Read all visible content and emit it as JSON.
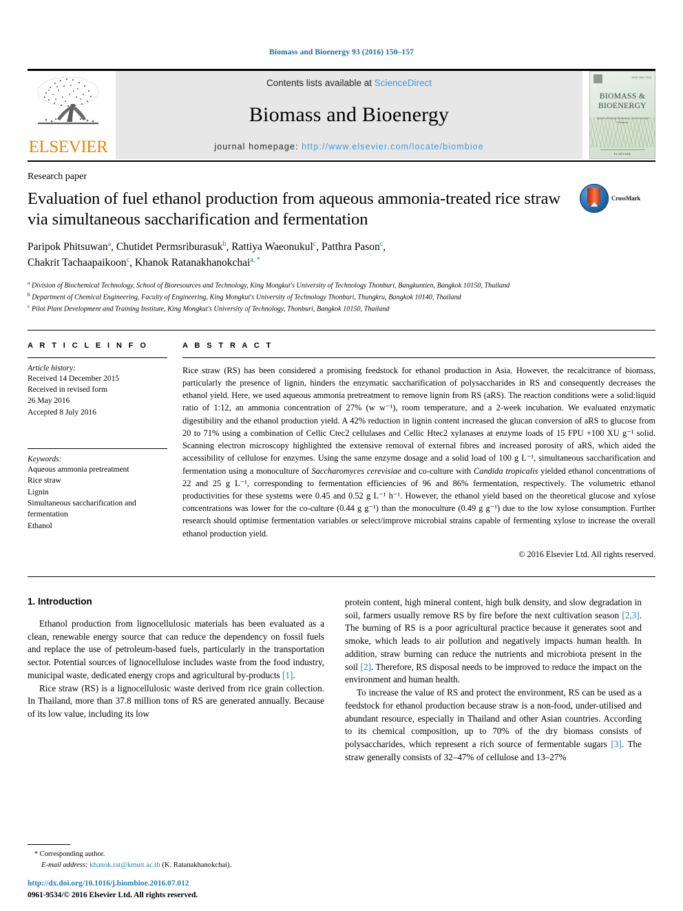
{
  "running_head": "Biomass and Bioenergy 93 (2016) 150–157",
  "masthead": {
    "contents_prefix": "Contents lists available at ",
    "sciencedirect": "ScienceDirect",
    "journal_title": "Biomass and Bioenergy",
    "homepage_prefix": "journal homepage: ",
    "homepage_url": "http://www.elsevier.com/locate/biombioe",
    "publisher_name": "ELSEVIER",
    "cover": {
      "title": "BIOMASS & BIOENERGY",
      "issn_line": "ISSN 0961-9534",
      "subtitle": "Aimed at Biomass Production, Conversion and Utilisation",
      "footer": "ELSEVIER"
    },
    "link_color": "#3b9ad9",
    "panel_color": "#e7e7e7",
    "elsevier_orange": "#f08100"
  },
  "article": {
    "type": "Research paper",
    "title": "Evaluation of fuel ethanol production from aqueous ammonia-treated rice straw via simultaneous saccharification and fermentation",
    "crossmark_label": "CrossMark",
    "authors": [
      {
        "name": "Paripok Phitsuwan",
        "marks": "a",
        "sep": ", "
      },
      {
        "name": "Chutidet Permsriburasuk",
        "marks": "b",
        "sep": ", "
      },
      {
        "name": "Rattiya Waeonukul",
        "marks": "c",
        "sep": ", "
      },
      {
        "name": "Patthra Pason",
        "marks": "c",
        "sep": ", "
      },
      {
        "name": "Chakrit Tachaapaikoon",
        "marks": "c",
        "sep": ", "
      },
      {
        "name": "Khanok Ratanakhanokchai",
        "marks": "a, *",
        "sep": ""
      }
    ],
    "affiliations": [
      {
        "mark": "a",
        "text": "Division of Biochemical Technology, School of Bioresources and Technology, King Mongkut's University of Technology Thonburi, Bangkuntien, Bangkok 10150, Thailand"
      },
      {
        "mark": "b",
        "text": "Department of Chemical Engineering, Faculty of Engineering, King Mongkut's University of Technology Thonburi, Thungkru, Bangkok 10140, Thailand"
      },
      {
        "mark": "c",
        "text": "Pilot Plant Development and Training Institute, King Mongkut's University of Technology, Thonburi, Bangkok 10150, Thailand"
      }
    ]
  },
  "article_info": {
    "heading": "A R T I C L E  I N F O",
    "history_label": "Article history:",
    "history": [
      "Received 14 December 2015",
      "Received in revised form",
      "26 May 2016",
      "Accepted 8 July 2016"
    ],
    "keywords_label": "Keywords:",
    "keywords": [
      "Aqueous ammonia pretreatment",
      "Rice straw",
      "Lignin",
      "Simultaneous saccharification and fermentation",
      "Ethanol"
    ]
  },
  "abstract": {
    "heading": "A B S T R A C T",
    "text": "Rice straw (RS) has been considered a promising feedstock for ethanol production in Asia. However, the recalcitrance of biomass, particularly the presence of lignin, hinders the enzymatic saccharification of polysaccharides in RS and consequently decreases the ethanol yield. Here, we used aqueous ammonia pretreatment to remove lignin from RS (aRS). The reaction conditions were a solid:liquid ratio of 1:12, an ammonia concentration of 27% (w w⁻¹), room temperature, and a 2-week incubation. We evaluated enzymatic digestibility and the ethanol production yield. A 42% reduction in lignin content increased the glucan conversion of aRS to glucose from 20 to 71% using a combination of Cellic Ctec2 cellulases and Cellic Htec2 xylanases at enzyme loads of 15 FPU +100 XU g⁻¹ solid. Scanning electron microscopy highlighted the extensive removal of external fibres and increased porosity of aRS, which aided the accessibility of cellulose for enzymes. Using the same enzyme dosage and a solid load of 100 g L⁻¹, simultaneous saccharification and fermentation using a monoculture of ",
    "italic_1": "Saccharomyces cerevisiae",
    "text_2": " and co-culture with ",
    "italic_2": "Candida tropicalis",
    "text_3": " yielded ethanol concentrations of 22 and 25 g L⁻¹, corresponding to fermentation efficiencies of 96 and 86% fermentation, respectively. The volumetric ethanol productivities for these systems were 0.45 and 0.52 g L⁻¹ h⁻¹. However, the ethanol yield based on the theoretical glucose and xylose concentrations was lower for the co-culture (0.44 g g⁻¹) than the monoculture (0.49 g g⁻¹) due to the low xylose consumption. Further research should optimise fermentation variables or select/improve microbial strains capable of fermenting xylose to increase the overall ethanol production yield.",
    "copyright": "© 2016 Elsevier Ltd. All rights reserved."
  },
  "introduction": {
    "heading": "1.  Introduction",
    "left_p1_a": "Ethanol production from lignocellulosic materials has been evaluated as a clean, renewable energy source that can reduce the dependency on fossil fuels and replace the use of petroleum-based fuels, particularly in the transportation sector. Potential sources of lignocellulose includes waste from the food industry, municipal waste, dedicated energy crops and agricultural by-products ",
    "left_p1_ref": "[1]",
    "left_p1_b": ".",
    "left_p2": "Rice straw (RS) is a lignocellulosic waste derived from rice grain collection. In Thailand, more than 37.8 million tons of RS are generated annually. Because of its low value, including its low",
    "right_p1_a": "protein content, high mineral content, high bulk density, and slow degradation in soil, farmers usually remove RS by fire before the next cultivation season ",
    "right_p1_ref1": "[2,3]",
    "right_p1_b": ". The burning of RS is a poor agricultural practice because it generates soot and smoke, which leads to air pollution and negatively impacts human health. In addition, straw burning can reduce the nutrients and microbiota present in the soil ",
    "right_p1_ref2": "[2]",
    "right_p1_c": ". Therefore, RS disposal needs to be improved to reduce the impact on the environment and human health.",
    "right_p2_a": "To increase the value of RS and protect the environment, RS can be used as a feedstock for ethanol production because straw is a non-food, under-utilised and abundant resource, especially in Thailand and other Asian countries. According to its chemical composition, up to 70% of the dry biomass consists of polysaccharides, which represent a rich source of fermentable sugars ",
    "right_p2_ref": "[3]",
    "right_p2_b": ". The straw generally consists of 32–47% of cellulose and 13–27%"
  },
  "footnote": {
    "star": "*",
    "corresponding": "Corresponding author.",
    "email_label": "E-mail address:",
    "email": "khanok.rat@kmutt.ac.th",
    "email_owner": "(K. Ratanakhanokchai)."
  },
  "page_footer": {
    "doi": "http://dx.doi.org/10.1016/j.biombioe.2016.07.012",
    "issn": "0961-9534/© 2016 Elsevier Ltd. All rights reserved."
  }
}
